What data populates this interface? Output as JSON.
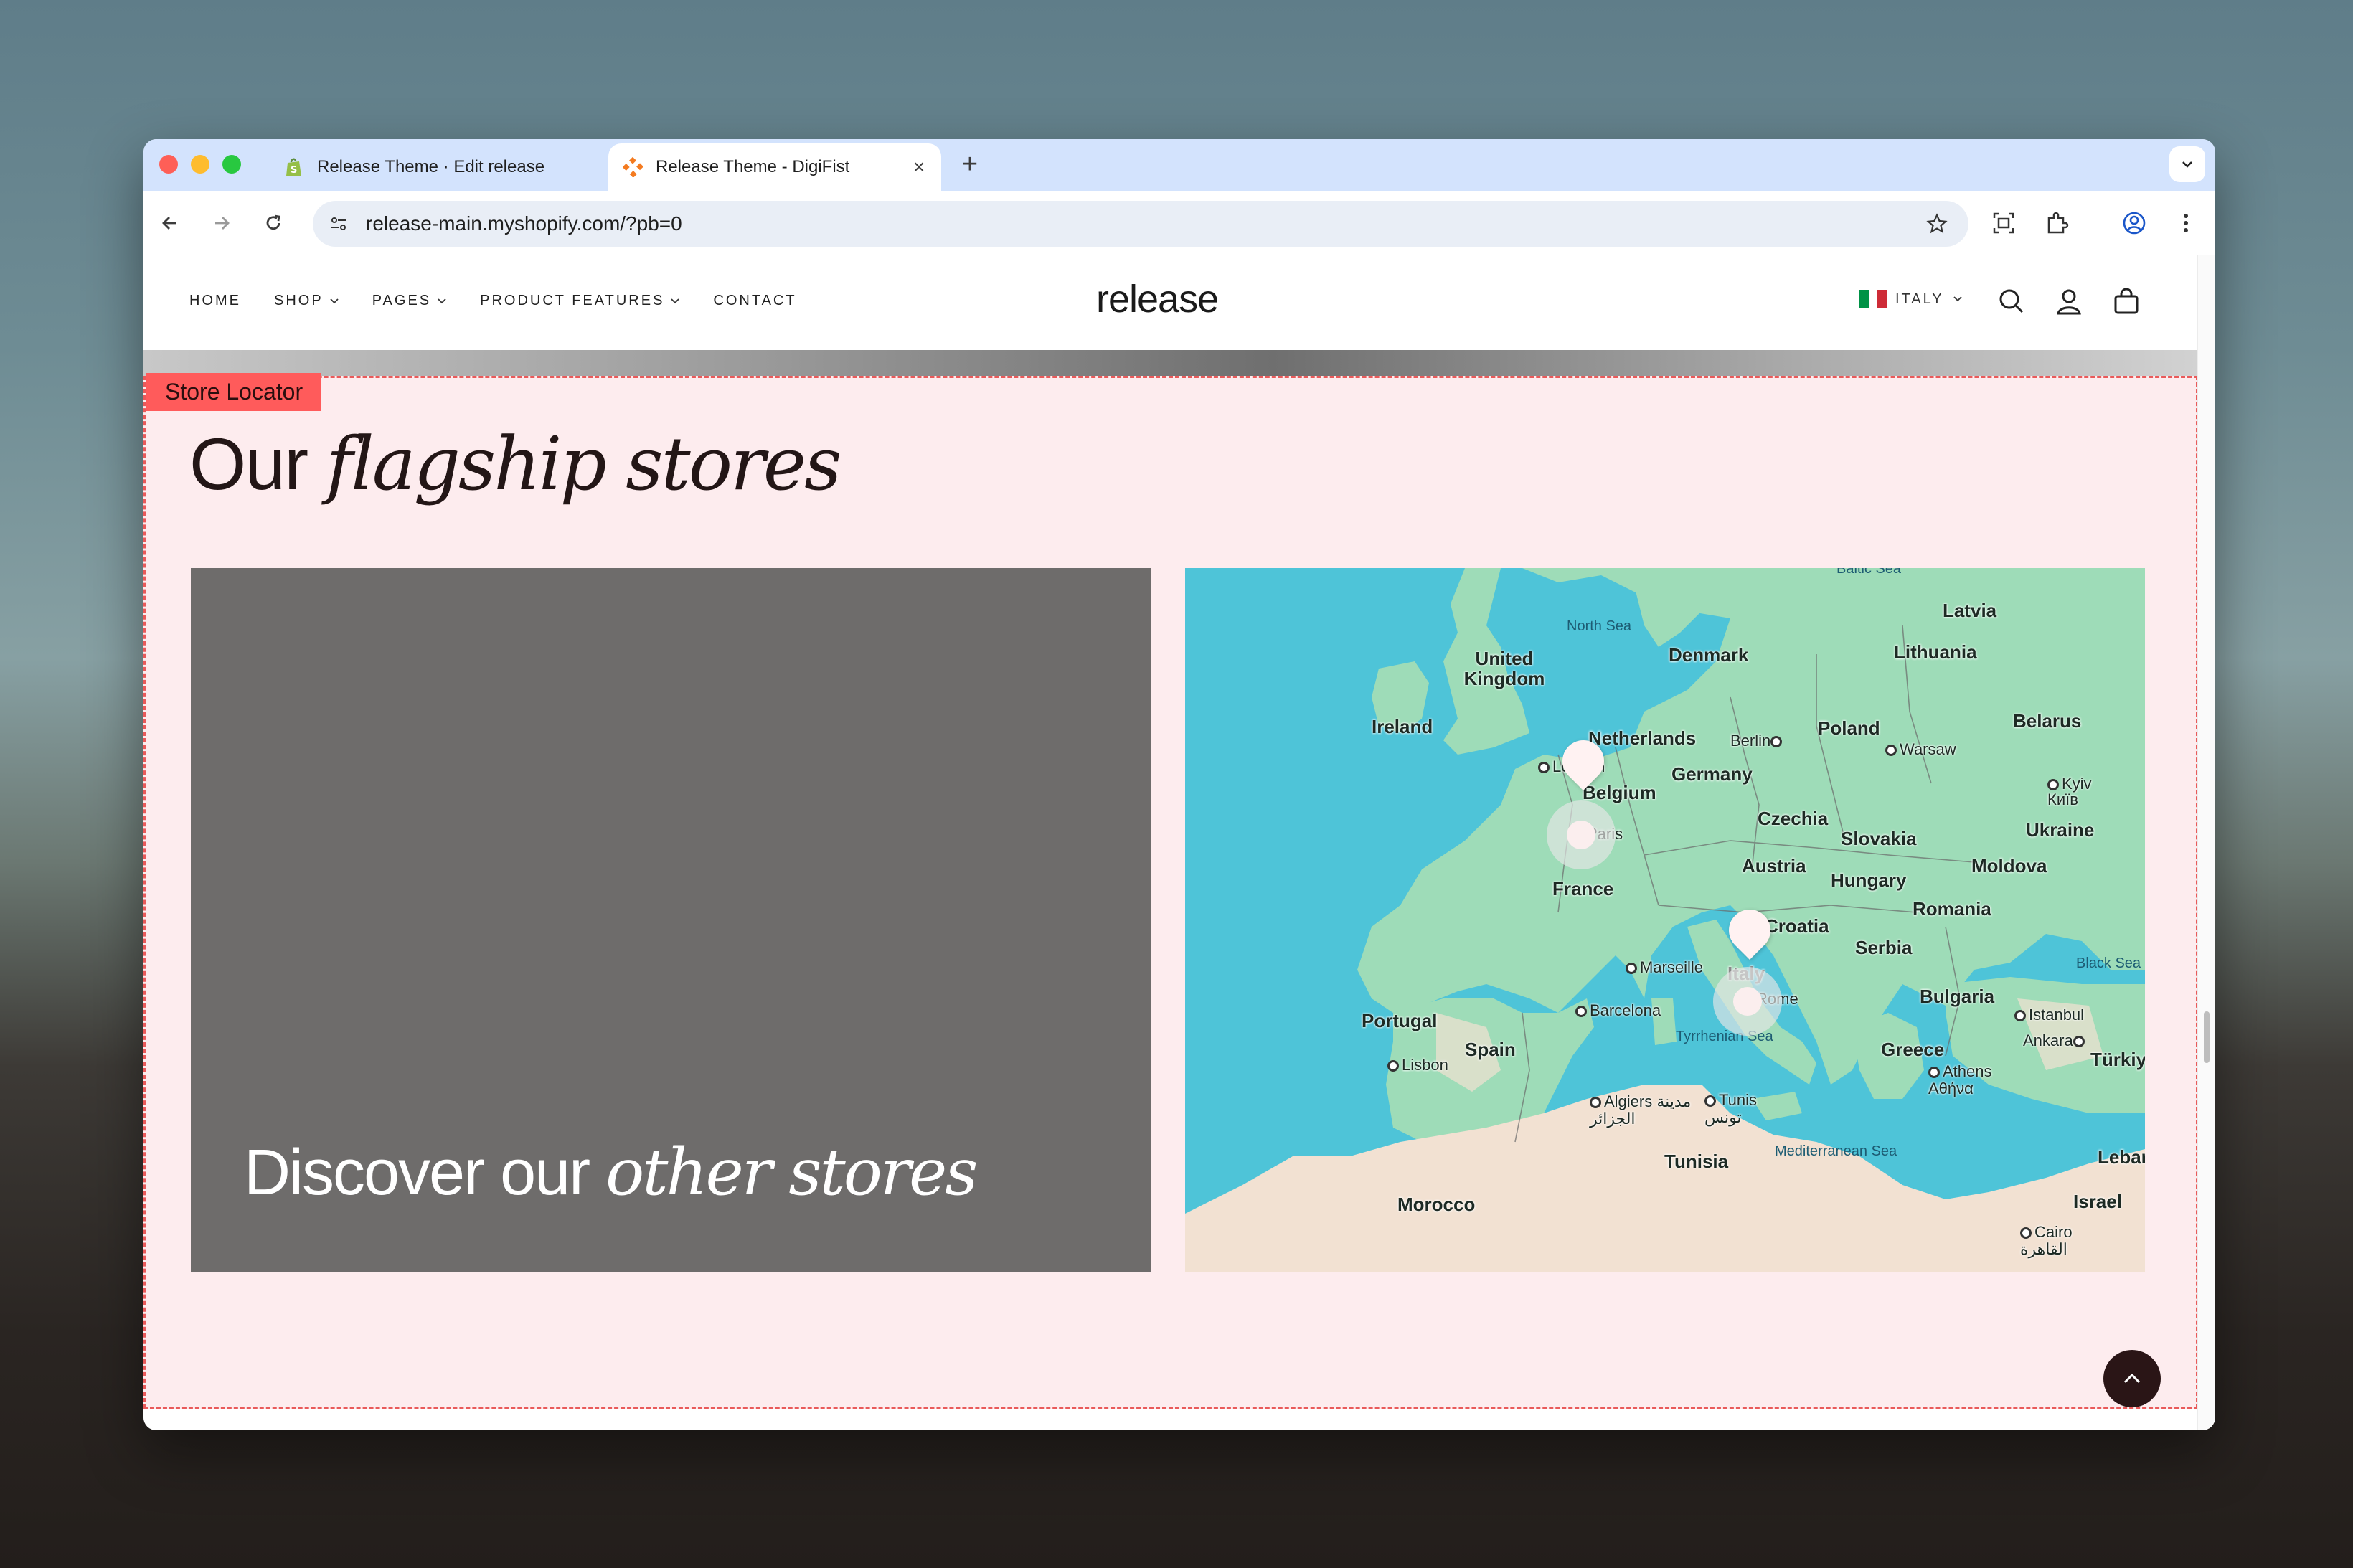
{
  "browser": {
    "tabs": [
      {
        "title": "Release Theme · Edit release",
        "favicon": "shopify-icon",
        "active": false
      },
      {
        "title": "Release Theme - DigiFist",
        "favicon": "digifist-icon",
        "active": true
      }
    ],
    "url": "release-main.myshopify.com/?pb=0"
  },
  "header": {
    "nav": [
      {
        "label": "HOME",
        "dropdown": false
      },
      {
        "label": "SHOP",
        "dropdown": true
      },
      {
        "label": "PAGES",
        "dropdown": true
      },
      {
        "label": "PRODUCT FEATURES",
        "dropdown": true
      },
      {
        "label": "CONTACT",
        "dropdown": false
      }
    ],
    "logo": "release",
    "locale": "ITALY"
  },
  "section": {
    "badge": "Store Locator",
    "heading_plain": "Our",
    "heading_italic": "flagship stores",
    "card_plain": "Discover our",
    "card_italic": "other stores"
  },
  "map": {
    "countries": [
      "Latvia",
      "Lithuania",
      "Denmark",
      "United Kingdom",
      "Ireland",
      "Netherlands",
      "Poland",
      "Belarus",
      "Germany",
      "Belgium",
      "Czechia",
      "Slovakia",
      "Ukraine",
      "Austria",
      "Moldova",
      "Hungary",
      "France",
      "Romania",
      "Croatia",
      "Serbia",
      "Italy",
      "Bulgaria",
      "Portugal",
      "Spain",
      "Greece",
      "Türkiye",
      "Tunisia",
      "Morocco",
      "Israel",
      "Lebanon"
    ],
    "cities": [
      "Berlin",
      "Warsaw",
      "Kyiv Київ",
      "London",
      "Paris",
      "Marseille",
      "Barcelona",
      "Rome",
      "Lisbon",
      "Algiers مدينة الجزائر",
      "Tunis تونس",
      "Istanbul",
      "Ankara",
      "Athens Αθήνα",
      "Cairo القاهرة"
    ],
    "seas": [
      "North Sea",
      "Baltic Sea",
      "Black Sea",
      "Tyrrhenian Sea",
      "Mediterranean Sea"
    ]
  },
  "colors": {
    "section_bg": "#fdecee",
    "badge": "#ff5b5b",
    "sea": "#4ec4d8",
    "land": "#9edcb8",
    "card": "#6e6c6b"
  }
}
